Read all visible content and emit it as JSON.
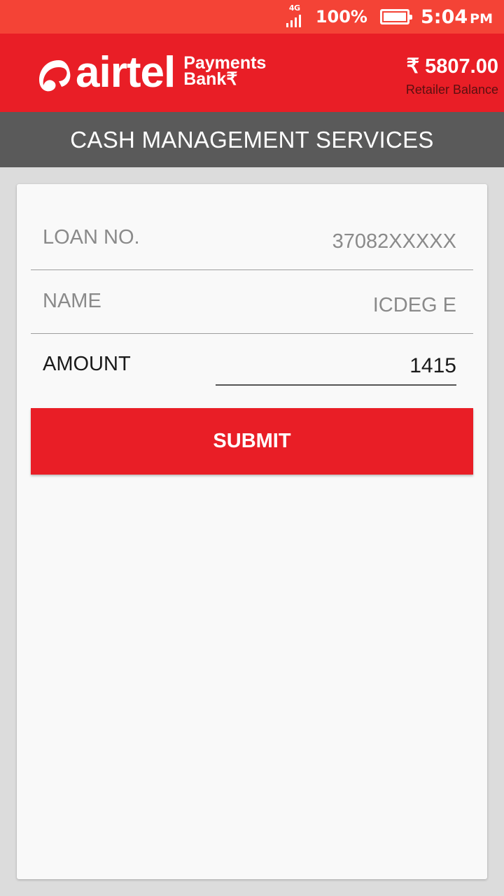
{
  "status_bar": {
    "network": "4G",
    "battery_percent": "100%",
    "time": "5:04",
    "ampm": "PM"
  },
  "header": {
    "brand_word": "airtel",
    "brand_sub_line1": "Payments",
    "brand_sub_line2": "Bank₹",
    "balance_amount": "₹ 5807.00",
    "balance_label": "Retailer Balance"
  },
  "title_bar": {
    "title": "CASH MANAGEMENT SERVICES"
  },
  "form": {
    "loan_label": "LOAN NO.",
    "loan_value": "37082XXXXX",
    "name_label": "NAME",
    "name_value": "ICDEG E",
    "amount_label": "AMOUNT",
    "amount_value": "1415",
    "submit_label": "SUBMIT"
  },
  "colors": {
    "status_bar": "#f44336",
    "brand_red": "#e91e26",
    "title_bar": "#5a5a5a",
    "background": "#dcdcdc"
  }
}
